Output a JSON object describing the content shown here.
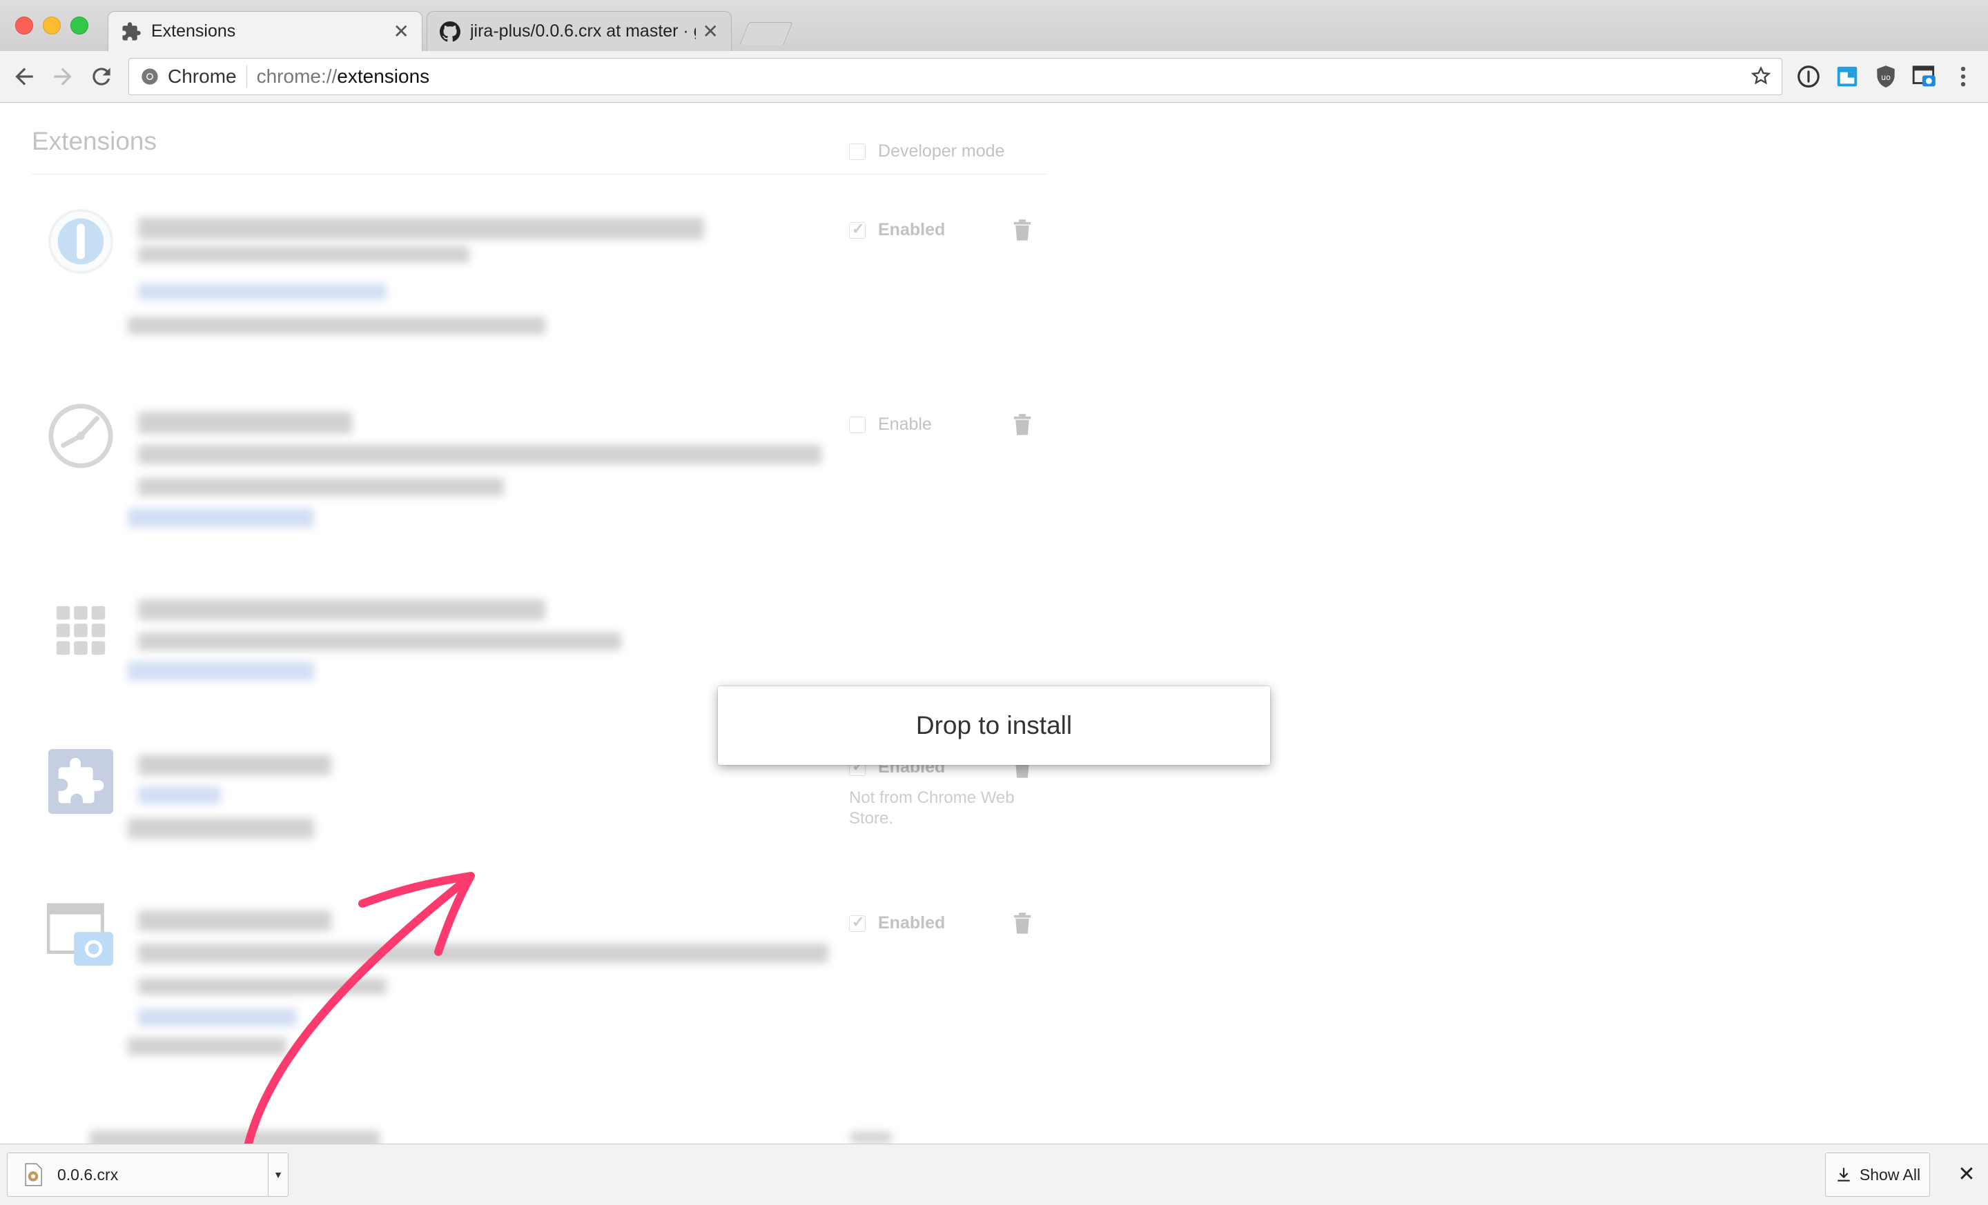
{
  "tabs": [
    {
      "title": "Extensions",
      "icon": "puzzle-icon"
    },
    {
      "title": "jira-plus/0.0.6.crx at master · g",
      "icon": "github-icon"
    }
  ],
  "omnibox": {
    "chip": "Chrome",
    "url_scheme": "chrome://",
    "url_host": "extensions"
  },
  "page": {
    "heading": "Extensions",
    "developer_mode_label": "Developer mode",
    "extensions": [
      {
        "status": "Enabled",
        "checked": true,
        "icon": "onepassword-icon"
      },
      {
        "status": "Enable",
        "checked": false,
        "icon": "clock-icon"
      },
      {
        "status": "",
        "checked": false,
        "icon": "apps-grid-icon"
      },
      {
        "status": "Enabled",
        "checked": true,
        "icon": "puzzle-icon",
        "note": "Not from Chrome Web Store."
      },
      {
        "status": "Enabled",
        "checked": true,
        "icon": "screenshot-icon"
      }
    ]
  },
  "overlay": {
    "drop_label": "Drop to install"
  },
  "download_shelf": {
    "file_name": "0.0.6.crx",
    "show_all_label": "Show All",
    "close_glyph": "✕"
  },
  "colors": {
    "arrow": "#fb3a6e",
    "traffic_red": "#fc5f57",
    "traffic_yellow": "#fdbc2e",
    "traffic_green": "#33c748"
  }
}
